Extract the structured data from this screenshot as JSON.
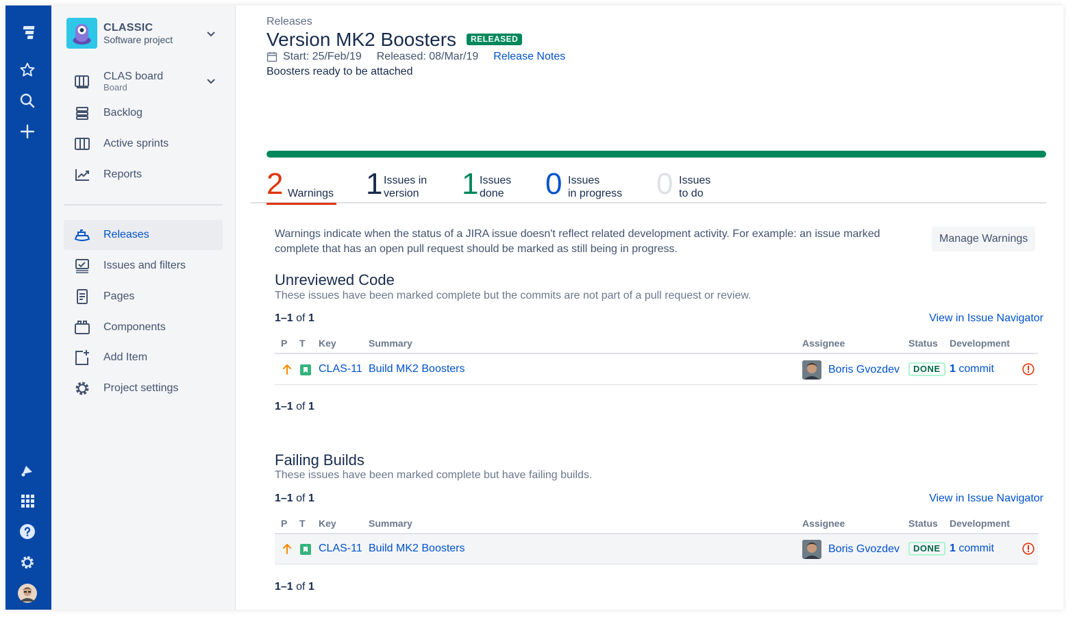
{
  "global_nav": {
    "icons": [
      "jira-logo-icon",
      "star-icon",
      "search-icon",
      "plus-icon",
      "notification-icon",
      "app-switcher-icon",
      "help-icon",
      "gear-icon",
      "user-avatar"
    ]
  },
  "sidebar": {
    "project_name": "CLASSIC",
    "project_type": "Software project",
    "board_name": "CLAS board",
    "board_sub": "Board",
    "items": [
      {
        "label": "Backlog",
        "icon": "backlog-icon"
      },
      {
        "label": "Active sprints",
        "icon": "active-sprints-icon"
      },
      {
        "label": "Reports",
        "icon": "reports-icon"
      },
      {
        "label": "Releases",
        "icon": "releases-icon"
      },
      {
        "label": "Issues and filters",
        "icon": "issues-icon"
      },
      {
        "label": "Pages",
        "icon": "pages-icon"
      },
      {
        "label": "Components",
        "icon": "components-icon"
      },
      {
        "label": "Add Item",
        "icon": "add-item-icon"
      },
      {
        "label": "Project settings",
        "icon": "settings-icon"
      }
    ]
  },
  "header": {
    "breadcrumb": "Releases",
    "title": "Version MK2 Boosters",
    "status_lozenge": "RELEASED",
    "start": "Start: 25/Feb/19",
    "released": "Released: 08/Mar/19",
    "release_notes": "Release Notes",
    "description": "Boosters ready to be attached"
  },
  "progress": {
    "done_fraction": 1.0
  },
  "stats": [
    {
      "num": "2",
      "line1": "Warnings",
      "line2": "",
      "color": "#de350b"
    },
    {
      "num": "1",
      "line1": "Issues in",
      "line2": "version",
      "color": "#172b4d"
    },
    {
      "num": "1",
      "line1": "Issues",
      "line2": "done",
      "color": "#00875a"
    },
    {
      "num": "0",
      "line1": "Issues",
      "line2": "in progress",
      "color": "#0052cc"
    },
    {
      "num": "0",
      "line1": "Issues",
      "line2": "to do",
      "color": "#dfe1e6"
    }
  ],
  "warnings": {
    "info": "Warnings indicate when the status of a JIRA issue doesn't reflect related development activity. For example: an issue marked complete that has an open pull request should be marked as still being in progress.",
    "manage_button": "Manage Warnings"
  },
  "sections": [
    {
      "title": "Unreviewed Code",
      "subtitle": "These issues have been marked complete but the commits are not part of a pull request or review.",
      "count_range": "1–1",
      "count_of": "of",
      "count_total": "1",
      "navigator_link": "View in Issue Navigator",
      "columns": {
        "p": "P",
        "t": "T",
        "key": "Key",
        "summary": "Summary",
        "assignee": "Assignee",
        "status": "Status",
        "development": "Development"
      },
      "rows": [
        {
          "key": "CLAS-11",
          "summary": "Build MK2 Boosters",
          "assignee": "Boris Gvozdev",
          "status": "DONE",
          "dev_count": "1",
          "dev_label": "commit"
        }
      ]
    },
    {
      "title": "Failing Builds",
      "subtitle": "These issues have been marked complete but have failing builds.",
      "count_range": "1–1",
      "count_of": "of",
      "count_total": "1",
      "navigator_link": "View in Issue Navigator",
      "columns": {
        "p": "P",
        "t": "T",
        "key": "Key",
        "summary": "Summary",
        "assignee": "Assignee",
        "status": "Status",
        "development": "Development"
      },
      "rows": [
        {
          "key": "CLAS-11",
          "summary": "Build MK2 Boosters",
          "assignee": "Boris Gvozdev",
          "status": "DONE",
          "dev_count": "1",
          "dev_label": "commit"
        }
      ]
    }
  ]
}
